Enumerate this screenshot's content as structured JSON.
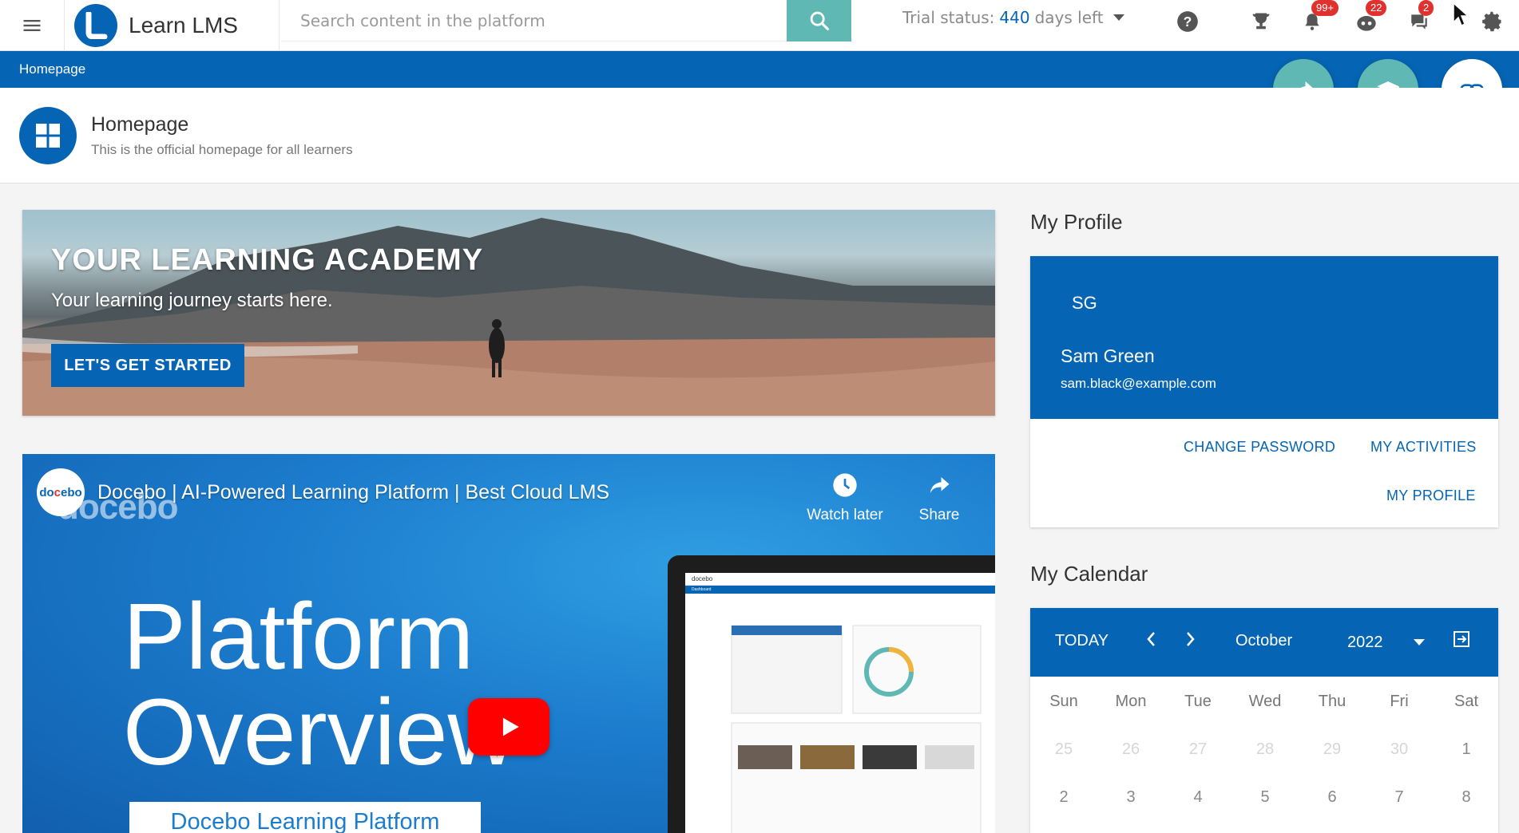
{
  "header": {
    "app_title": "Learn LMS",
    "search_placeholder": "Search content in the platform",
    "trial_prefix": "Trial status:",
    "trial_days": "440",
    "trial_suffix": "days left",
    "badges": {
      "notifications": "99+",
      "bot": "22",
      "messages": "2"
    },
    "icons": [
      "menu-icon",
      "search-icon",
      "help-icon",
      "trophy-icon",
      "bell-icon",
      "bot-icon",
      "chat-icon",
      "gear-icon"
    ]
  },
  "breadcrumb": {
    "current": "Homepage"
  },
  "page": {
    "title": "Homepage",
    "subtitle": "This is the official homepage for all learners"
  },
  "hero": {
    "title": "YOUR LEARNING ACADEMY",
    "subtitle": "Your learning journey starts here.",
    "cta": "LET'S GET STARTED"
  },
  "video": {
    "channel_logo": "docebo",
    "title": "Docebo | AI-Powered Learning Platform | Best Cloud LMS",
    "watch_later": "Watch later",
    "share": "Share",
    "headline_1": "Platform",
    "headline_2": "Overview",
    "caption": "Docebo Learning Platform",
    "screen_brand": "docebo",
    "screen_tab": "Dashboard"
  },
  "profile": {
    "section_title": "My Profile",
    "initials": "SG",
    "name": "Sam Green",
    "email": "sam.black@example.com",
    "change_password": "CHANGE PASSWORD",
    "my_activities": "MY ACTIVITIES",
    "my_profile": "MY PROFILE"
  },
  "calendar": {
    "section_title": "My Calendar",
    "today": "TODAY",
    "month": "October",
    "year": "2022",
    "weekdays": [
      "Sun",
      "Mon",
      "Tue",
      "Wed",
      "Thu",
      "Fri",
      "Sat"
    ],
    "week1": [
      "25",
      "26",
      "27",
      "28",
      "29",
      "30",
      "1"
    ],
    "week2": [
      "2",
      "3",
      "4",
      "5",
      "6",
      "7",
      "8"
    ]
  },
  "colors": {
    "primary": "#0565b4",
    "teal": "#5fb8b4",
    "badge": "#e0312f"
  }
}
